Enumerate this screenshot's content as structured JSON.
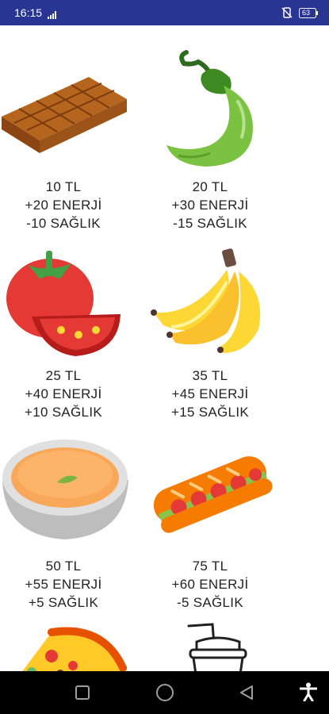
{
  "status": {
    "time": "16:15",
    "battery": "63"
  },
  "items": [
    {
      "name": "chocolate",
      "price": "10 TL",
      "energy": "+20 ENERJİ",
      "health": "-10 SAĞLIK"
    },
    {
      "name": "pepper",
      "price": "20 TL",
      "energy": "+30 ENERJİ",
      "health": "-15 SAĞLIK"
    },
    {
      "name": "tomato",
      "price": "25 TL",
      "energy": "+40 ENERJİ",
      "health": "+10 SAĞLIK"
    },
    {
      "name": "banana",
      "price": "35 TL",
      "energy": "+45 ENERJİ",
      "health": "+15 SAĞLIK"
    },
    {
      "name": "soup",
      "price": "50 TL",
      "energy": "+55 ENERJİ",
      "health": "+5 SAĞLIK"
    },
    {
      "name": "sandwich",
      "price": "75 TL",
      "energy": "+60 ENERJİ",
      "health": "-5 SAĞLIK"
    }
  ],
  "partial_items": [
    {
      "name": "pizza"
    },
    {
      "name": "drink"
    }
  ]
}
